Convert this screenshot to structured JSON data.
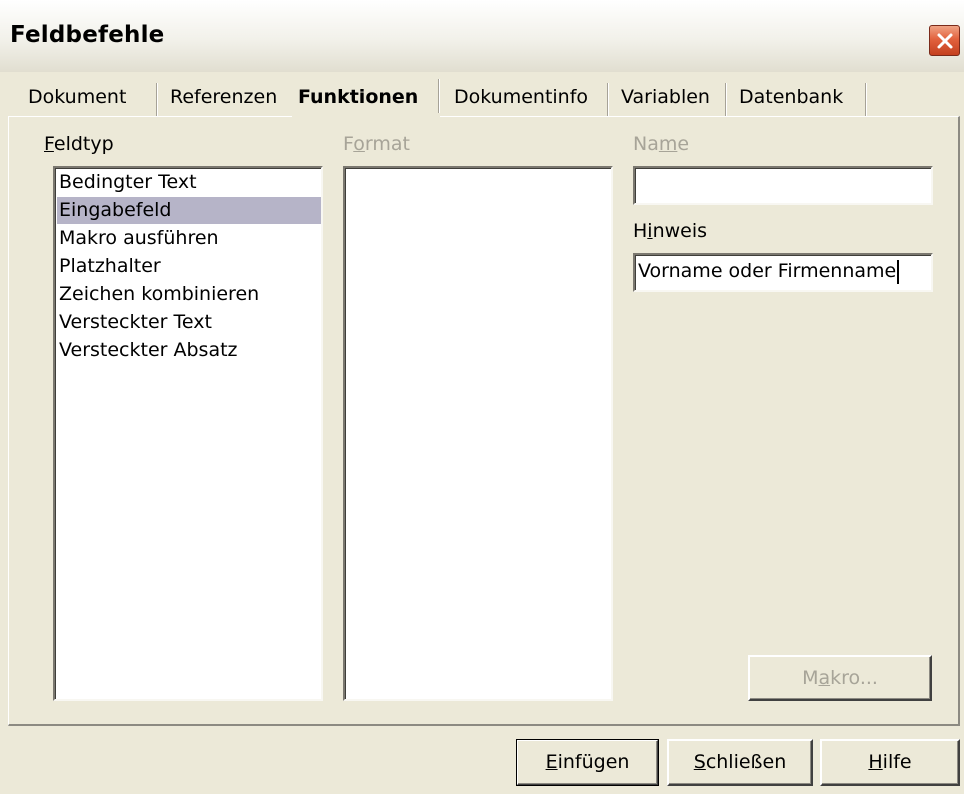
{
  "window": {
    "title": "Feldbefehle",
    "close_icon": "close-icon"
  },
  "tabs": [
    {
      "label": "Dokument",
      "active": false
    },
    {
      "label": "Referenzen",
      "active": false
    },
    {
      "label": "Funktionen",
      "active": true
    },
    {
      "label": "Dokumentinfo",
      "active": false
    },
    {
      "label": "Variablen",
      "active": false
    },
    {
      "label": "Datenbank",
      "active": false
    }
  ],
  "feldtyp": {
    "label_mnemonic": "F",
    "label_rest": "eldtyp",
    "items": [
      {
        "label": "Bedingter Text",
        "selected": false
      },
      {
        "label": "Eingabefeld",
        "selected": true
      },
      {
        "label": "Makro ausführen",
        "selected": false
      },
      {
        "label": "Platzhalter",
        "selected": false
      },
      {
        "label": "Zeichen kombinieren",
        "selected": false
      },
      {
        "label": "Versteckter Text",
        "selected": false
      },
      {
        "label": "Versteckter Absatz",
        "selected": false
      }
    ]
  },
  "format": {
    "label_pre": "F",
    "label_mnemonic": "o",
    "label_rest": "rmat",
    "enabled": false
  },
  "name": {
    "label_pre": "Na",
    "label_mnemonic": "m",
    "label_rest": "e",
    "enabled": false,
    "value": ""
  },
  "hinweis": {
    "label_pre": "H",
    "label_mnemonic": "i",
    "label_rest": "nweis",
    "value": "Vorname oder Firmenname"
  },
  "makro_button": {
    "label_pre": "M",
    "label_mnemonic": "a",
    "label_rest": "kro...",
    "enabled": false
  },
  "buttons": {
    "insert": {
      "mnemonic": "E",
      "rest": "infügen"
    },
    "close": {
      "mnemonic": "S",
      "rest": "chließen"
    },
    "help": {
      "mnemonic": "H",
      "rest": "ilfe"
    }
  },
  "colors": {
    "dialog_bg": "#ece9d8",
    "selection": "#b6b4c8",
    "disabled_text": "#a7a498",
    "close_button": "#e2623e"
  }
}
